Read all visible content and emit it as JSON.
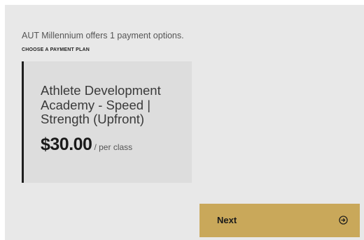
{
  "intro_text": "AUT Millennium offers 1 payment options.",
  "section_label": "CHOOSE A PAYMENT PLAN",
  "plans": [
    {
      "name": "Athlete Development Academy - Speed | Strength (Upfront)",
      "price": "$30.00",
      "unit": "/ per class"
    }
  ],
  "next_button": {
    "label": "Next",
    "icon": "arrow-right-circle-icon"
  },
  "colors": {
    "panel_bg": "#e8e8e8",
    "card_bg": "#dddddd",
    "card_accent": "#1e1e1e",
    "button_bg": "#c9a85a"
  }
}
